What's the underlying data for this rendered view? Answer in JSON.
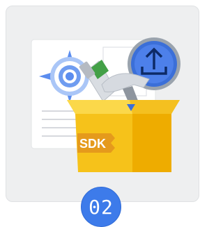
{
  "card": {
    "background": "#eeeff0",
    "border": "#dfe1e3"
  },
  "illustration": {
    "box_label": "SDK",
    "icons": [
      "document-icon",
      "compass-gear-icon",
      "upload-cloud-icon",
      "hammer-icon",
      "toolbox-icon"
    ],
    "colors": {
      "box_front": "#f6c21a",
      "box_side": "#eeac00",
      "box_flap": "#f9d23d",
      "label_tag": "#e59a1c",
      "upload_circle": "#3b6fd8",
      "compass_blue": "#5b8def",
      "tube_green": "#43a047"
    }
  },
  "step": {
    "number": "02",
    "color": "#3d7bea"
  }
}
